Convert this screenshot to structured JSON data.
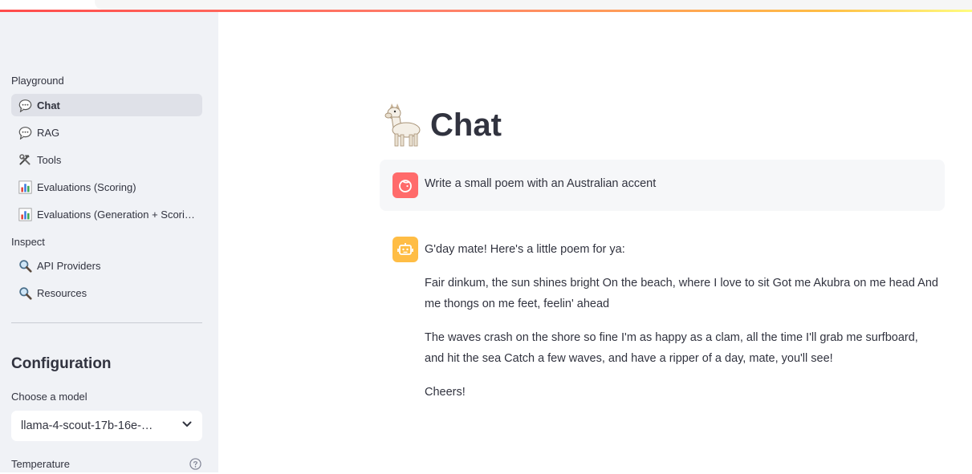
{
  "sidebar": {
    "sections": {
      "playground": "Playground",
      "inspect": "Inspect"
    },
    "items": [
      {
        "label": "Chat",
        "icon": "speech-bubble-icon"
      },
      {
        "label": "RAG",
        "icon": "speech-bubble-icon"
      },
      {
        "label": "Tools",
        "icon": "hammer-wrench-icon"
      },
      {
        "label": "Evaluations (Scoring)",
        "icon": "bar-chart-icon"
      },
      {
        "label": "Evaluations (Generation + Scori…",
        "icon": "bar-chart-icon"
      },
      {
        "label": "API Providers",
        "icon": "magnifier-icon"
      },
      {
        "label": "Resources",
        "icon": "magnifier-icon"
      }
    ],
    "configuration": {
      "title": "Configuration",
      "model_label": "Choose a model",
      "model_value": "llama-4-scout-17b-16e-…",
      "temperature_label": "Temperature"
    }
  },
  "main": {
    "title": "Chat",
    "messages": [
      {
        "role": "user",
        "text": "Write a small poem with an Australian accent"
      },
      {
        "role": "assistant",
        "paragraphs": [
          "G'day mate! Here's a little poem for ya:",
          "Fair dinkum, the sun shines bright On the beach, where I love to sit Got me Akubra on me head And me thongs on me feet, feelin' ahead",
          "The waves crash on the shore so fine I'm as happy as a clam, all the time I'll grab me surfboard, and hit the sea Catch a few waves, and have a ripper of a day, mate, you'll see!",
          "Cheers!"
        ]
      }
    ]
  },
  "colors": {
    "accent": "#ff4b4b",
    "sidebar_bg": "#f0f2f6",
    "user_avatar": "#ff6b6b",
    "bot_avatar": "#ffbd45"
  }
}
